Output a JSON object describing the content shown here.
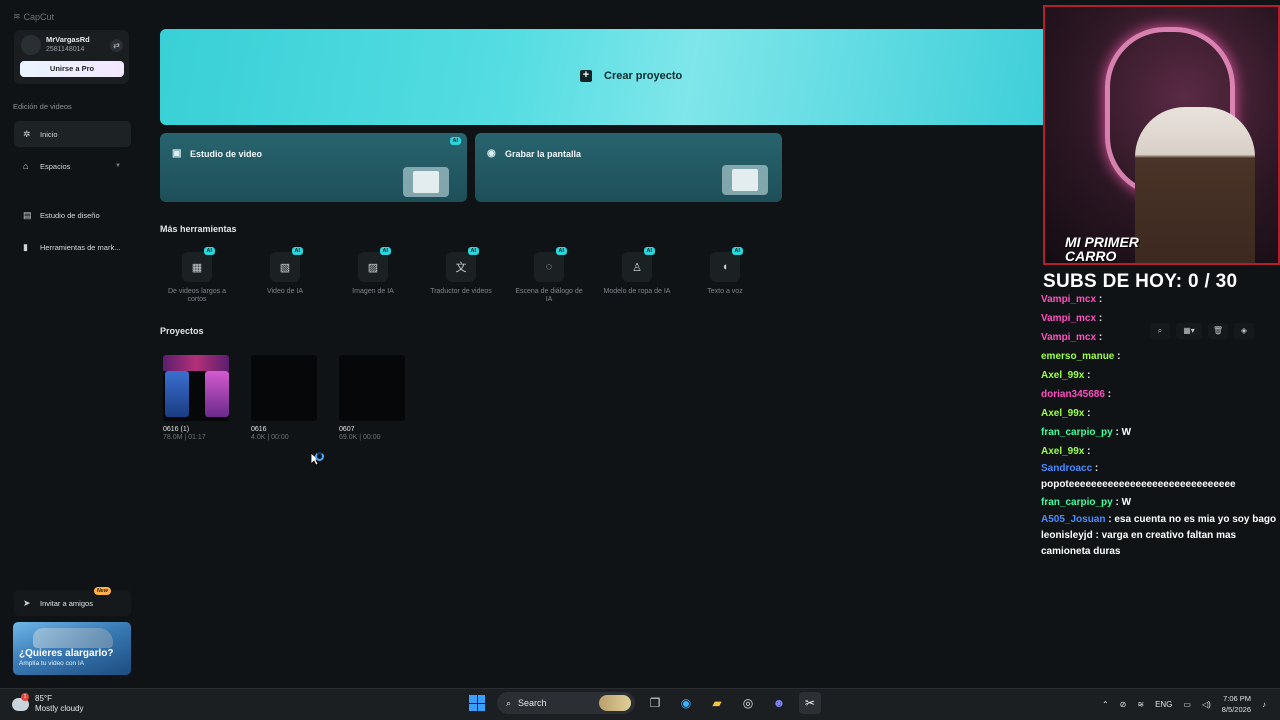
{
  "app": {
    "name": "CapCut"
  },
  "profile": {
    "username": "MrVargasRd",
    "user_id": "2581148014",
    "pro_button": "Unirse a Pro"
  },
  "sidebar": {
    "section_label": "Edición de videos",
    "items": [
      {
        "label": "Inicio",
        "icon": "home-icon"
      },
      {
        "label": "Espacios",
        "icon": "cloud-icon"
      },
      {
        "label": "Estudio de diseño",
        "icon": "design-icon"
      },
      {
        "label": "Herramientas de mark...",
        "icon": "marketing-icon"
      }
    ],
    "invite": {
      "label": "Invitar a amigos",
      "badge": "New"
    },
    "promo": {
      "title": "¿Quieres alargarlo?",
      "subtitle": "Amplía tu video con IA"
    }
  },
  "main": {
    "create_project": "Crear proyecto",
    "cards": [
      {
        "label": "Estudio de video",
        "tag": "AI"
      },
      {
        "label": "Grabar la pantalla",
        "tag": ""
      }
    ],
    "tools_title": "Más herramientas",
    "tools": [
      {
        "label": "De videos largos a cortos",
        "tag": "AI",
        "icon": "film-icon"
      },
      {
        "label": "Video de IA",
        "tag": "AI",
        "icon": "ai-video-icon"
      },
      {
        "label": "Imagen de IA",
        "tag": "AI",
        "icon": "image-icon"
      },
      {
        "label": "Traductor de videos",
        "tag": "AI",
        "icon": "translate-icon"
      },
      {
        "label": "Escena de diálogo de IA",
        "tag": "AI",
        "icon": "dialog-icon"
      },
      {
        "label": "Modelo de ropa de IA",
        "tag": "AI",
        "icon": "shirt-icon"
      },
      {
        "label": "Texto a voz",
        "tag": "AI",
        "icon": "voice-icon"
      }
    ],
    "projects_title": "Proyectos",
    "projects": [
      {
        "name": "0616 (1)",
        "meta": "78.0M | 01:17"
      },
      {
        "name": "0616",
        "meta": "4.0K | 00:00"
      },
      {
        "name": "0607",
        "meta": "69.0K | 00:00"
      }
    ]
  },
  "stream": {
    "cam_caption_line1": "MI PRIMER",
    "cam_caption_line2": "CARRO",
    "subs": "SUBS DE HOY: 0 / 30",
    "chat": [
      {
        "user": "Vampi_mcx",
        "text": "",
        "color": "#ff4fc0"
      },
      {
        "user": "Vampi_mcx",
        "text": "",
        "color": "#ff4fc0"
      },
      {
        "user": "Vampi_mcx",
        "text": "",
        "color": "#ff4fc0"
      },
      {
        "user": "emerso_manue",
        "text": "",
        "color": "#9cff4a"
      },
      {
        "user": "Axel_99x",
        "text": "",
        "color": "#9cff4a"
      },
      {
        "user": "dorian345686",
        "text": "",
        "color": "#ff4fc0"
      },
      {
        "user": "Axel_99x",
        "text": "",
        "color": "#9cff4a"
      },
      {
        "user": "fran_carpio_py",
        "text": "W",
        "color": "#3dff9e"
      },
      {
        "user": "Axel_99x",
        "text": "",
        "color": "#9cff4a"
      },
      {
        "user": "Sandroacc",
        "text": "popoteeeeeeeeeeeeeeeeeeeeeeeeeeeeee",
        "color": "#4a8bff"
      },
      {
        "user": "fran_carpio_py",
        "text": "W",
        "color": "#3dff9e"
      },
      {
        "user": "A505_Josuan",
        "text": "esa cuenta no es mia yo soy bago",
        "color": "#4a8bff"
      },
      {
        "user": "leonisleyjd",
        "text": "varga en creativo faltan mas camioneta duras",
        "color": "#ffffff"
      }
    ]
  },
  "taskbar": {
    "weather_temp": "85°F",
    "weather_desc": "Mostly cloudy",
    "weather_alert": "1",
    "search_placeholder": "Search",
    "language": "ENG",
    "time": "7:06 PM",
    "date": "8/5/2026"
  }
}
